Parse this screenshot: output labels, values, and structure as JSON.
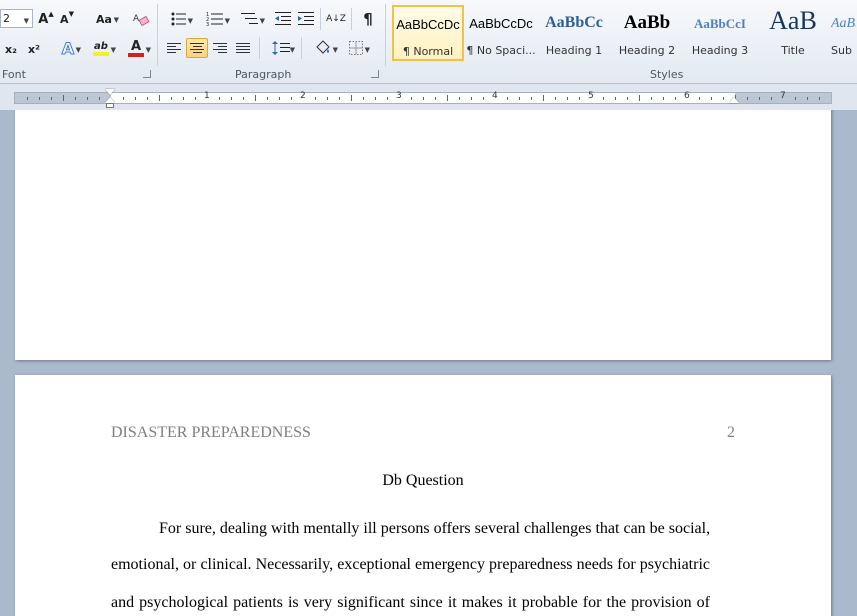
{
  "ribbon": {
    "font_group": {
      "label": "Font",
      "font_size": "2",
      "grow_font": "A",
      "shrink_font": "A",
      "change_case": "Aa",
      "subscript": "x₂",
      "superscript": "x²",
      "text_effects": "A",
      "highlight": "ab",
      "font_color": "A",
      "font_color_hex": "#d61f1f",
      "highlight_hex": "#f7ee2c"
    },
    "paragraph_group": {
      "label": "Paragraph",
      "sort": "A↓Z",
      "pilcrow": "¶"
    },
    "styles_group": {
      "label": "Styles",
      "items": [
        {
          "sample": "AaBbCcDc",
          "name": "¶ Normal",
          "selected": true
        },
        {
          "sample": "AaBbCcDc",
          "name": "¶ No Spaci..."
        },
        {
          "sample": "AaBbCc",
          "name": "Heading 1"
        },
        {
          "sample": "AaBb",
          "name": "Heading 2"
        },
        {
          "sample": "AaBbCcI",
          "name": "Heading 3"
        },
        {
          "sample": "AaB",
          "name": "Title"
        },
        {
          "sample": "AaBb",
          "name": "Sub"
        }
      ]
    }
  },
  "ruler": {
    "numbers": [
      "1",
      "2",
      "3",
      "4",
      "5",
      "6",
      "7"
    ]
  },
  "document": {
    "header_left": "DISASTER PREPAREDNESS",
    "page_number": "2",
    "title": "Db Question",
    "body_lines": [
      "For sure, dealing with mentally ill persons offers several challenges that can be social,",
      "emotional, or clinical. Necessarily, exceptional emergency preparedness needs for psychiatric",
      "and psychological patients is very significant since it makes it probable for the provision of"
    ]
  },
  "colors": {
    "heading_blue": "#2f5d93",
    "heading2_color": "#000000",
    "selection_gold": "#f0c24a"
  }
}
